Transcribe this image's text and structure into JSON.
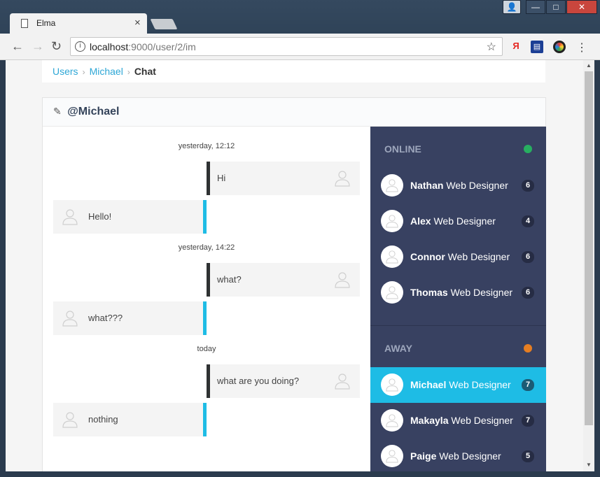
{
  "browser": {
    "tab_title": "Elma",
    "tab_close": "×",
    "url_host": "localhost",
    "url_path": ":9000/user/2/im",
    "ext_yandex": "Я"
  },
  "breadcrumb": {
    "items": [
      "Users",
      "Michael"
    ],
    "current": "Chat",
    "separator": "›"
  },
  "panel": {
    "title": "@Michael"
  },
  "chat": {
    "groups": [
      {
        "timestamp": "yesterday, 12:12",
        "messages": [
          {
            "dir": "out",
            "text": "Hi"
          },
          {
            "dir": "in",
            "text": "Hello!"
          }
        ]
      },
      {
        "timestamp": "yesterday, 14:22",
        "messages": [
          {
            "dir": "out",
            "text": "what?"
          },
          {
            "dir": "in",
            "text": "what???"
          }
        ]
      },
      {
        "timestamp": "today",
        "messages": [
          {
            "dir": "out",
            "text": "what are you doing?"
          },
          {
            "dir": "in",
            "text": "nothing"
          }
        ]
      }
    ]
  },
  "users": {
    "online_title": "ONLINE",
    "online_color": "#27ae60",
    "away_title": "AWAY",
    "away_color": "#e67e22",
    "online": [
      {
        "name": "Nathan",
        "role": "Web Designer",
        "count": "6"
      },
      {
        "name": "Alex",
        "role": "Web Designer",
        "count": "4"
      },
      {
        "name": "Connor",
        "role": "Web Designer",
        "count": "6"
      },
      {
        "name": "Thomas",
        "role": "Web Designer",
        "count": "6"
      }
    ],
    "away": [
      {
        "name": "Michael",
        "role": "Web Designer",
        "count": "7",
        "active": true
      },
      {
        "name": "Makayla",
        "role": "Web Designer",
        "count": "7"
      },
      {
        "name": "Paige",
        "role": "Web Designer",
        "count": "5"
      }
    ]
  },
  "colors": {
    "accent": "#1ebce5",
    "sidebar_bg": "#384161",
    "link": "#2ea7d6"
  }
}
